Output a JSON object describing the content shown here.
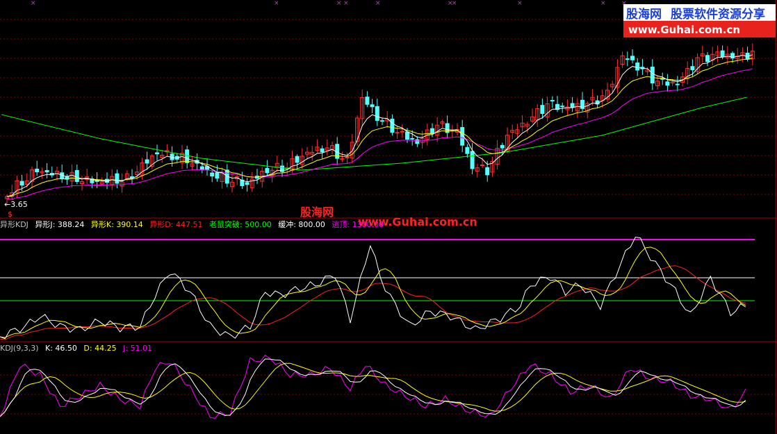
{
  "logo": {
    "brand": "股海网",
    "slogan": "股票软件资源分享",
    "url": "www.Guhai.com.cn"
  },
  "watermark": {
    "brand": "股海网",
    "url": "www.Guhai.com.cn"
  },
  "colors": {
    "background": "#000000",
    "up_candle": "#ff3232",
    "down_candle": "#54ffff",
    "ma_short": "#ffffff",
    "ma_mid": "#ffff00",
    "ma_long": "#ff00ff",
    "ma_longest": "#00ff00",
    "grid": "#8b0000",
    "divider": "#aa0000",
    "kdj_k": "#ffffff",
    "kdj_d": "#ffff00",
    "kdj_j": "#ff00ff",
    "ind_j": "#ffffff",
    "ind_k": "#ffff00",
    "ind_d": "#ff2020",
    "level_mouse": "#00ff00",
    "level_buffer": "#ffffff",
    "level_escape": "#ff00ff"
  },
  "chart_data": [
    {
      "type": "candlestick",
      "title": "",
      "low_price_label": "3.65",
      "signal_label": "$",
      "moving_averages": [
        "ma_short",
        "ma_mid",
        "ma_long",
        "ma_longest"
      ],
      "grid": true
    },
    {
      "type": "line",
      "title": "异形KDJ",
      "series": [
        {
          "name": "异形J",
          "last_value": "388.24",
          "color": "#ffffff"
        },
        {
          "name": "异形K",
          "last_value": "390.14",
          "color": "#ffff00"
        },
        {
          "name": "异形D",
          "last_value": "447.51",
          "color": "#ff2020"
        }
      ],
      "levels": [
        {
          "name": "老鼠突破",
          "value": "500.00",
          "color": "#00ff00"
        },
        {
          "name": "缓冲",
          "value": "800.00",
          "color": "#ffffff"
        },
        {
          "name": "逃顶",
          "value": "1300.00",
          "color": "#ff00ff"
        }
      ]
    },
    {
      "type": "line",
      "title": "KDJ(9,3,3)",
      "series": [
        {
          "name": "K",
          "last_value": "46.50",
          "color": "#ffffff"
        },
        {
          "name": "D",
          "last_value": "44.25",
          "color": "#ffff00"
        },
        {
          "name": "J",
          "last_value": "51.01",
          "color": "#ff00ff"
        }
      ]
    }
  ]
}
